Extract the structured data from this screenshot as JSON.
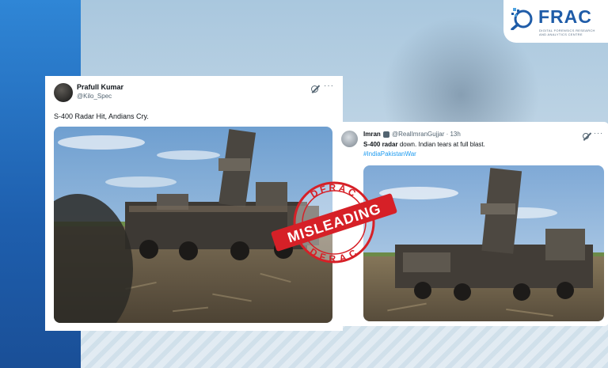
{
  "logo": {
    "word": "FRAC",
    "tagline": "DIGITAL FORENSICS RESEARCH AND ANALYTICS CENTRE"
  },
  "tweet1": {
    "name": "Prafull Kumar",
    "handle": "@Kilo_Spec",
    "text": "S-400 Radar Hit, Andians Cry.",
    "more": "···"
  },
  "tweet2": {
    "name": "Imran",
    "handle": "@RealImranGujjar · 13h",
    "text_bold": "S-400 radar",
    "text_rest": " down. Indian tears at full blast.",
    "hashtag": "#IndiaPakistanWar",
    "more": "···"
  },
  "stamp": {
    "label": "MISLEADING",
    "top": "DFRAC",
    "bottom": "DFRAC"
  },
  "colors": {
    "stamp_red": "#d62027",
    "brand_blue": "#1f5ca8",
    "hashtag": "#1d9bf0"
  }
}
